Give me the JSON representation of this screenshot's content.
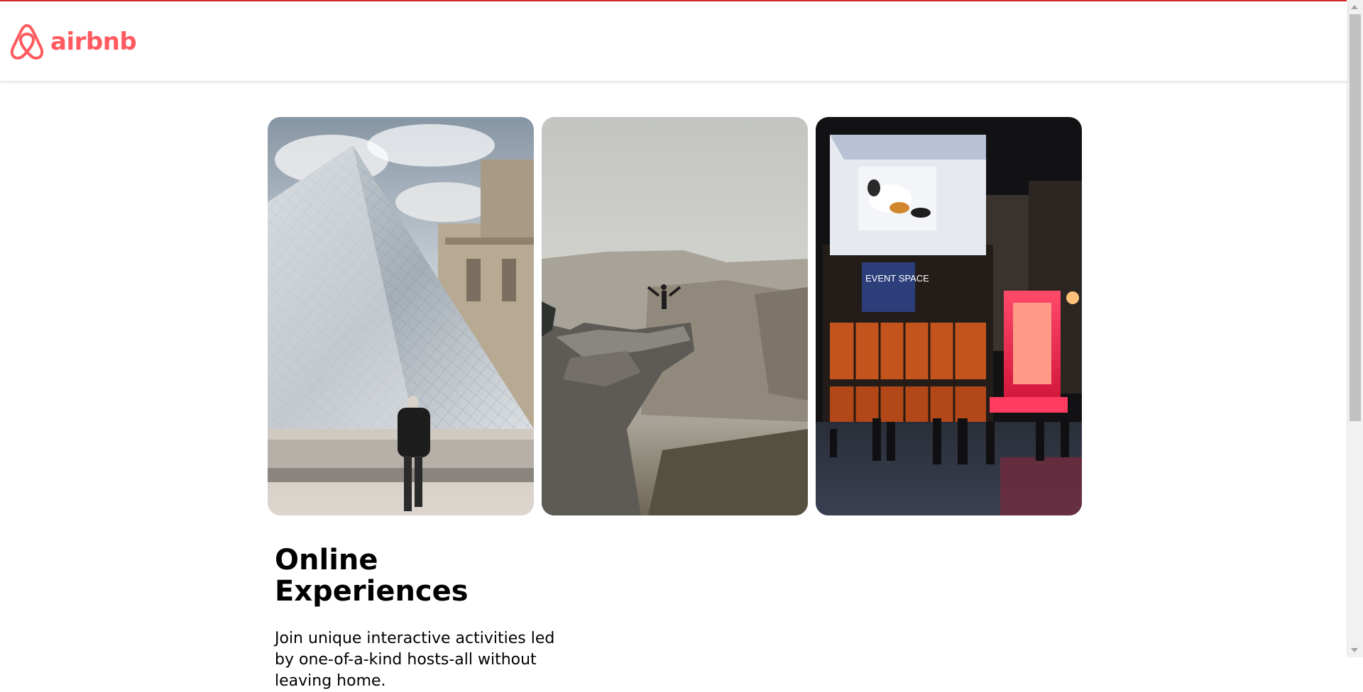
{
  "brand": {
    "name": "airbnb",
    "color": "#ff5a5f",
    "icon": "airbnb-belo-icon"
  },
  "gallery": [
    {
      "name": "glass-pyramid-photo"
    },
    {
      "name": "mountain-cliff-photo"
    },
    {
      "name": "night-city-billboard-photo",
      "sign_text": "EVENT SPACE"
    }
  ],
  "main": {
    "heading": "Online Experiences",
    "description": "Join unique interactive activities led by one-of-a-kind hosts-all without leaving home."
  },
  "colors": {
    "accent_bar": "#d6262c",
    "text": "#000000",
    "background": "#ffffff"
  }
}
